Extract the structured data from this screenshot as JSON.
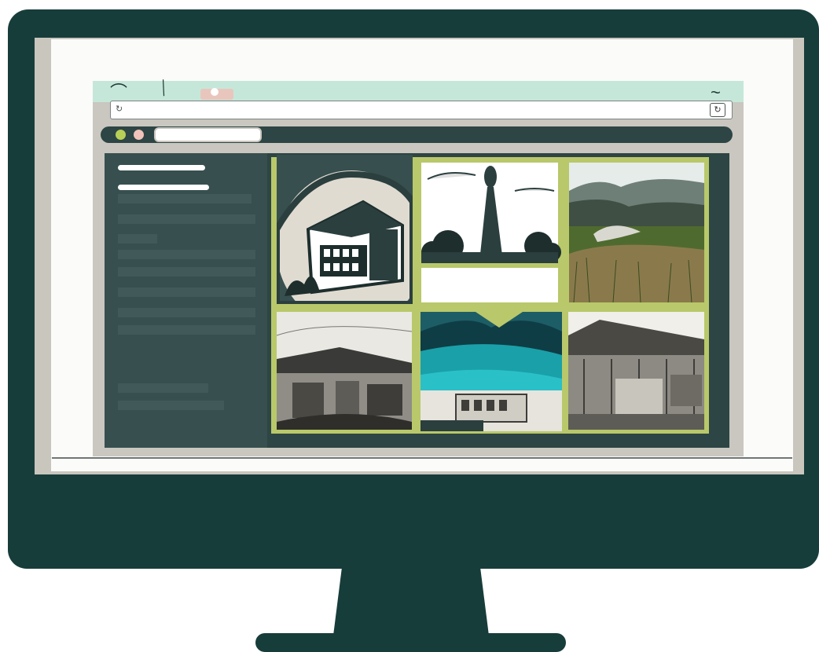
{
  "browser": {
    "address_glyph": "↻",
    "refresh_glyph": "↻",
    "window_dots": [
      {
        "name": "green",
        "color": "#b7cf56"
      },
      {
        "name": "pink",
        "color": "#f0c2b9"
      }
    ]
  },
  "sidebar": {
    "heading_bars": 2,
    "placeholder_rows": 10
  },
  "gallery": {
    "tiles": [
      {
        "name": "tile-arched-building",
        "icon": "building-illustration"
      },
      {
        "name": "tile-statue-monument",
        "icon": "monument-illustration"
      },
      {
        "name": "tile-mountain-field",
        "icon": "landscape-photo"
      },
      {
        "name": "tile-village-street",
        "icon": "village-sketch"
      },
      {
        "name": "tile-teal-mountain-town",
        "icon": "mountain-town-illustration"
      },
      {
        "name": "tile-wooden-house",
        "icon": "wooden-house-photo"
      }
    ]
  },
  "colors": {
    "monitor": "#173d3b",
    "titlebar": "#c5e7d9",
    "sidebar": "#37504f",
    "accent_border": "#b9c86a"
  }
}
